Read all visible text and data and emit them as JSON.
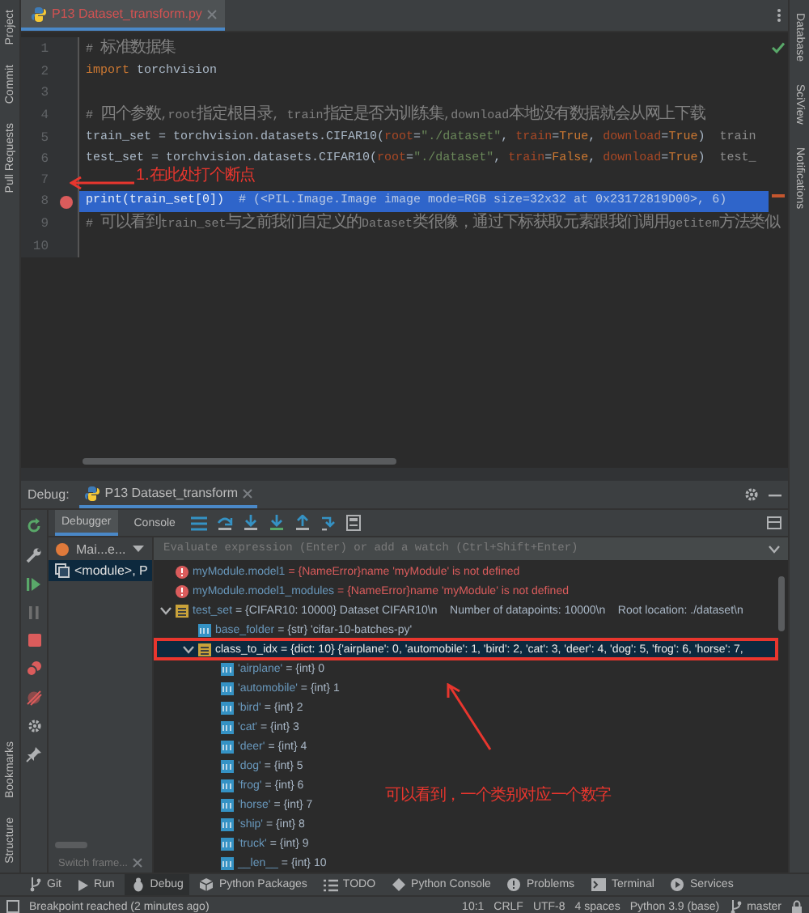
{
  "left_strip": {
    "top": [
      "Project",
      "Commit",
      "Pull Requests"
    ],
    "bottom": [
      "Bookmarks",
      "Structure"
    ]
  },
  "right_strip": [
    "Database",
    "SciView",
    "Notifications"
  ],
  "editor": {
    "tabs": [
      {
        "label": "P13 Dataset_transform.py",
        "selected": true
      }
    ],
    "lines": [
      {
        "number": "1",
        "breakpoint": false,
        "current": false,
        "segments": [
          {
            "kind": "comment",
            "text": "# 标准数据集"
          }
        ]
      },
      {
        "number": "2",
        "breakpoint": false,
        "current": false,
        "segments": [
          {
            "kind": "keyword",
            "text": "import"
          },
          {
            "kind": "plain",
            "text": " torchvision"
          }
        ]
      },
      {
        "number": "3",
        "breakpoint": false,
        "current": false
      },
      {
        "number": "4",
        "breakpoint": false,
        "current": false,
        "segments": [
          {
            "kind": "comment",
            "text": "# 四个参数,root指定根目录, train指定是否为训练集,download本地没有数据就会从网上下载"
          }
        ]
      },
      {
        "number": "5",
        "breakpoint": false,
        "current": false,
        "segments": [
          {
            "kind": "plain",
            "text": "train_set = torchvision.datasets.CIFAR10("
          },
          {
            "kind": "param",
            "text": "root"
          },
          {
            "kind": "plain",
            "text": "="
          },
          {
            "kind": "string",
            "text": "\"./dataset\""
          },
          {
            "kind": "plain",
            "text": ", "
          },
          {
            "kind": "param",
            "text": "train"
          },
          {
            "kind": "plain",
            "text": "="
          },
          {
            "kind": "keyword",
            "text": "True"
          },
          {
            "kind": "plain",
            "text": ", "
          },
          {
            "kind": "param",
            "text": "download"
          },
          {
            "kind": "plain",
            "text": "="
          },
          {
            "kind": "keyword",
            "text": "True"
          },
          {
            "kind": "plain",
            "text": ")"
          },
          {
            "kind": "hint",
            "text": "train"
          }
        ]
      },
      {
        "number": "6",
        "breakpoint": false,
        "current": false,
        "segments": [
          {
            "kind": "plain",
            "text": "test_set = torchvision.datasets.CIFAR10("
          },
          {
            "kind": "param",
            "text": "root"
          },
          {
            "kind": "plain",
            "text": "="
          },
          {
            "kind": "string",
            "text": "\"./dataset\""
          },
          {
            "kind": "plain",
            "text": ", "
          },
          {
            "kind": "param",
            "text": "train"
          },
          {
            "kind": "plain",
            "text": "="
          },
          {
            "kind": "keyword",
            "text": "False"
          },
          {
            "kind": "plain",
            "text": ", "
          },
          {
            "kind": "param",
            "text": "download"
          },
          {
            "kind": "plain",
            "text": "="
          },
          {
            "kind": "keyword",
            "text": "True"
          },
          {
            "kind": "plain",
            "text": ")"
          },
          {
            "kind": "hint",
            "text": "test_"
          }
        ]
      },
      {
        "number": "7",
        "breakpoint": false,
        "current": false
      },
      {
        "number": "8",
        "breakpoint": true,
        "current": true,
        "segments": [
          {
            "kind": "plain",
            "text": "print(train_set[0])"
          },
          {
            "kind": "hint",
            "text": "# (<PIL.Image.Image image mode=RGB size=32x32 at 0x23172819D00>, 6)"
          }
        ]
      },
      {
        "number": "9",
        "breakpoint": false,
        "current": false,
        "segments": [
          {
            "kind": "comment",
            "text": "# 可以看到train_set与之前我们自定义的Dataset类很像，通过下标获取元素跟我们调用getitem方法类似"
          }
        ]
      },
      {
        "number": "10",
        "breakpoint": false,
        "current": false
      }
    ]
  },
  "debug": {
    "label": "Debug:",
    "session_tabs": [
      {
        "label": "P13 Dataset_transform",
        "selected": true
      }
    ],
    "view_tabs": [
      {
        "label": "Debugger",
        "selected": true
      },
      {
        "label": "Console",
        "selected": false
      }
    ],
    "thread_dropdown": "Mai...e...",
    "frames": [
      {
        "label": "<module>, P",
        "selected": true
      }
    ],
    "switch_frame": "Switch frame...",
    "evaluate": {
      "placeholder": "Evaluate expression (Enter) or add a watch (Ctrl+Shift+Enter)"
    },
    "variables": [
      {
        "kind": "error",
        "name": "myModule.model1",
        "value": "= {NameError}name 'myModule' is not defined",
        "selected": false,
        "annotated": false
      },
      {
        "kind": "error",
        "name": "myModule.model1_modules",
        "value": "= {NameError}name 'myModule' is not defined",
        "selected": false,
        "annotated": false
      },
      {
        "kind": "object",
        "name": "test_set",
        "value": "= {CIFAR10: 10000} Dataset CIFAR10\\n    Number of datapoints: 10000\\n    Root location: ./dataset\\n",
        "selected": false,
        "annotated": false,
        "expanded": true,
        "children": [
          {
            "kind": "field",
            "name": "base_folder",
            "value": "= {str} 'cifar-10-batches-py'",
            "selected": false,
            "annotated": false
          },
          {
            "kind": "object",
            "name": "class_to_idx",
            "value": "= {dict: 10} {'airplane': 0, 'automobile': 1, 'bird': 2, 'cat': 3, 'deer': 4, 'dog': 5, 'frog': 6, 'horse': 7,",
            "selected": true,
            "annotated": true,
            "expanded": true,
            "children": [
              {
                "kind": "field",
                "name": "'airplane'",
                "value": "= {int} 0",
                "selected": false,
                "annotated": false
              },
              {
                "kind": "field",
                "name": "'automobile'",
                "value": "= {int} 1",
                "selected": false,
                "annotated": false
              },
              {
                "kind": "field",
                "name": "'bird'",
                "value": "= {int} 2",
                "selected": false,
                "annotated": false
              },
              {
                "kind": "field",
                "name": "'cat'",
                "value": "= {int} 3",
                "selected": false,
                "annotated": false
              },
              {
                "kind": "field",
                "name": "'deer'",
                "value": "= {int} 4",
                "selected": false,
                "annotated": false
              },
              {
                "kind": "field",
                "name": "'dog'",
                "value": "= {int} 5",
                "selected": false,
                "annotated": false
              },
              {
                "kind": "field",
                "name": "'frog'",
                "value": "= {int} 6",
                "selected": false,
                "annotated": false
              },
              {
                "kind": "field",
                "name": "'horse'",
                "value": "= {int} 7",
                "selected": false,
                "annotated": false
              },
              {
                "kind": "field",
                "name": "'ship'",
                "value": "= {int} 8",
                "selected": false,
                "annotated": false
              },
              {
                "kind": "field",
                "name": "'truck'",
                "value": "= {int} 9",
                "selected": false,
                "annotated": false
              },
              {
                "kind": "field",
                "name": "__len__",
                "value": "= {int} 10",
                "selected": false,
                "annotated": false
              }
            ]
          }
        ]
      }
    ]
  },
  "annotations": [
    {
      "text": "1.在此处打个断点"
    },
    {
      "text": "可以看到，一个类别对应一个数字"
    }
  ],
  "tool_windows": [
    {
      "label": "Git",
      "selected": false
    },
    {
      "label": "Run",
      "selected": false
    },
    {
      "label": "Debug",
      "selected": true
    },
    {
      "label": "Python Packages",
      "selected": false
    },
    {
      "label": "TODO",
      "selected": false
    },
    {
      "label": "Python Console",
      "selected": false
    },
    {
      "label": "Problems",
      "selected": false
    },
    {
      "label": "Terminal",
      "selected": false
    },
    {
      "label": "Services",
      "selected": false
    }
  ],
  "status_bar": {
    "message": "Breakpoint reached (2 minutes ago)",
    "items": [
      "10:1",
      "CRLF",
      "UTF-8",
      "4 spaces",
      "Python 3.9 (base)"
    ],
    "branch": "master"
  }
}
